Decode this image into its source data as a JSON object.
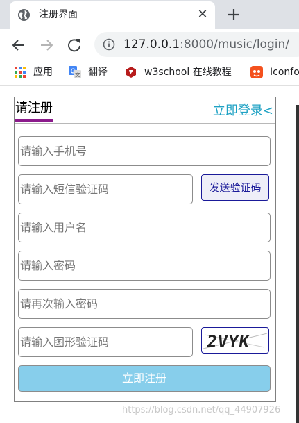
{
  "browser": {
    "tab_title": "注册界面",
    "tab_close": "✕",
    "url_host": "127.0.0.1",
    "url_rest": ":8000/music/login/",
    "bookmarks": [
      {
        "label": "应用",
        "icon": "apps-grid-icon"
      },
      {
        "label": "翻译",
        "icon": "translate-icon"
      },
      {
        "label": "w3school 在线教程",
        "icon": "w3school-icon"
      },
      {
        "label": "Iconfo",
        "icon": "iconfont-icon"
      }
    ]
  },
  "form": {
    "tab_register": "请注册",
    "tab_login": "立即登录<",
    "phone_placeholder": "请输入手机号",
    "sms_code_placeholder": "请输入短信验证码",
    "send_code_label": "发送验证码",
    "username_placeholder": "请输入用户名",
    "password_placeholder": "请输入密码",
    "password_confirm_placeholder": "请再次输入密码",
    "captcha_placeholder": "请输入图形验证码",
    "captcha_text": "2VYK",
    "submit_label": "立即注册"
  },
  "watermark": "https://blog.csdn.net/qq_44907926",
  "colors": {
    "accent_underline": "#8b1a8b",
    "login_link": "#1fa2c4",
    "submit_bg": "#87ceeb",
    "button_border": "#1a1a99"
  }
}
